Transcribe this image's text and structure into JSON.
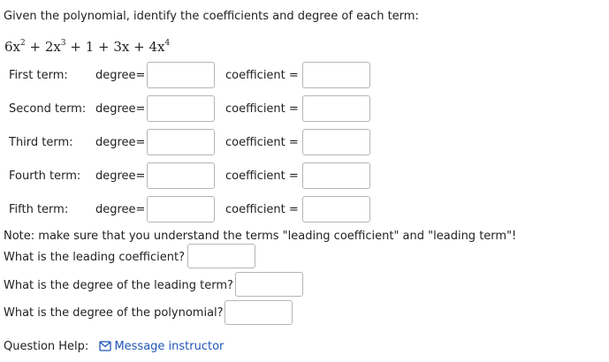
{
  "instruction": "Given the polynomial, identify the coefficients and degree of each term:",
  "polynomial": {
    "t1": "6x",
    "e1": "2",
    "p1": " + 2x",
    "e2": "3",
    "p2": " + 1 + 3x + 4x",
    "e3": "4"
  },
  "terms": [
    {
      "label": "First term:",
      "degree_label": "degree=",
      "coefficient_label": "coefficient =",
      "degree_value": "",
      "coefficient_value": ""
    },
    {
      "label": "Second term:",
      "degree_label": "degree=",
      "coefficient_label": "coefficient =",
      "degree_value": "",
      "coefficient_value": ""
    },
    {
      "label": "Third term:",
      "degree_label": "degree=",
      "coefficient_label": "coefficient =",
      "degree_value": "",
      "coefficient_value": ""
    },
    {
      "label": "Fourth term:",
      "degree_label": "degree=",
      "coefficient_label": "coefficient =",
      "degree_value": "",
      "coefficient_value": ""
    },
    {
      "label": "Fifth term:",
      "degree_label": "degree=",
      "coefficient_label": "coefficient =",
      "degree_value": "",
      "coefficient_value": ""
    }
  ],
  "note": "Note: make sure that you understand the terms \"leading coefficient\" and \"leading term\"!",
  "questions": {
    "leading_coefficient": "What is the leading coefficient?",
    "leading_degree": "What is the degree of the leading term?",
    "poly_degree": "What is the degree of the polynomial?"
  },
  "help": {
    "label": "Question Help:",
    "message_link": "Message instructor",
    "icon": "envelope-icon"
  }
}
